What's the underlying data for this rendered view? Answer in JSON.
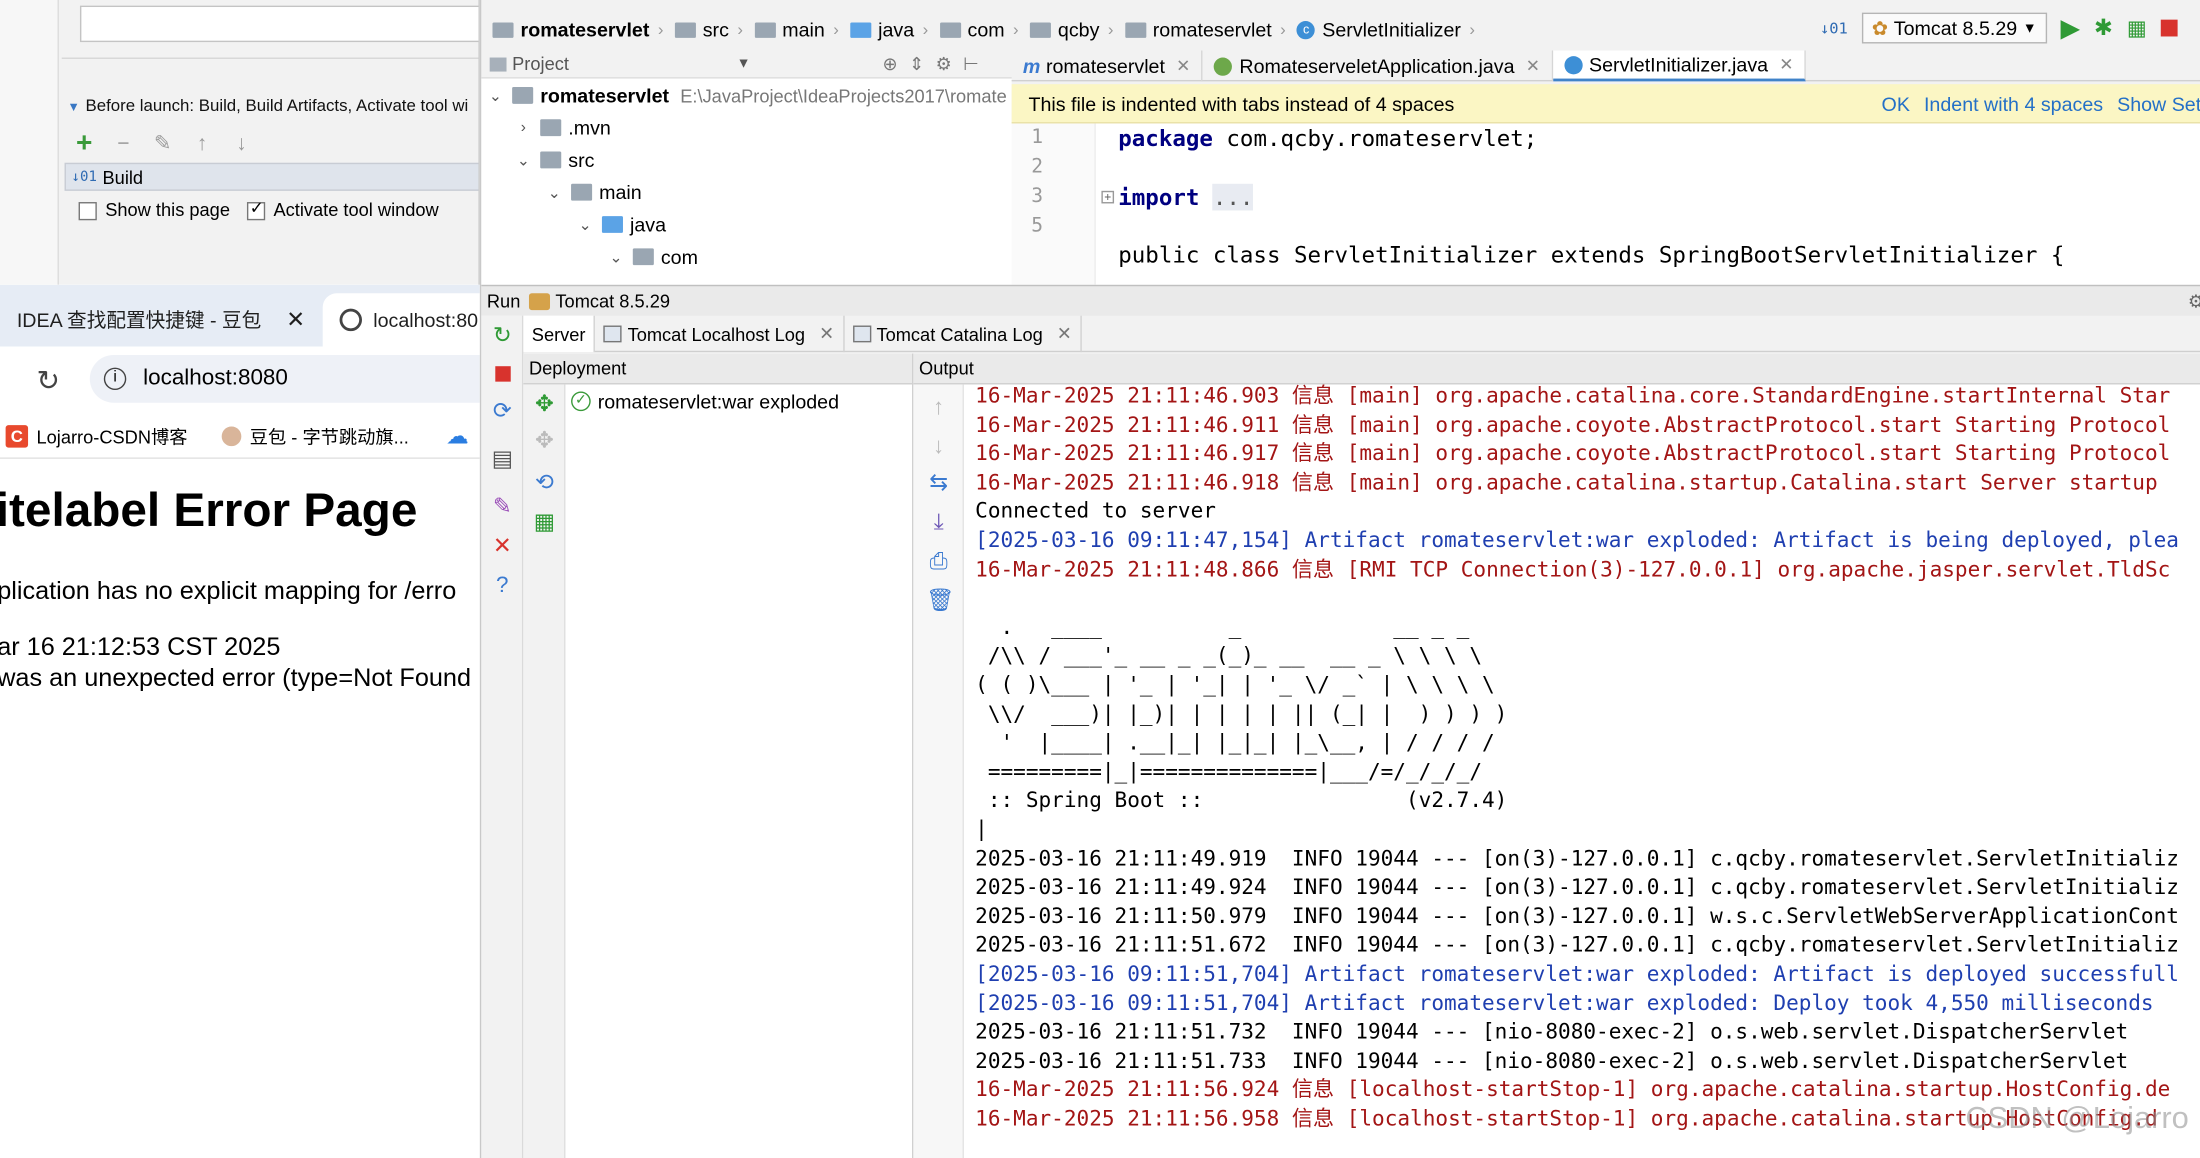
{
  "run_config": {
    "before_launch": "Before launch: Build, Build Artifacts, Activate tool wi",
    "build_item": "Build",
    "show_this_page": "Show this page",
    "activate_tool_window": "Activate tool window"
  },
  "browser": {
    "tabs": [
      {
        "label": "IDEA 查找配置快捷键 - 豆包"
      },
      {
        "label": "localhost:80"
      }
    ],
    "address": "localhost:8080",
    "bookmarks": [
      {
        "label": "Lojarro-CSDN博客"
      },
      {
        "label": "豆包 - 字节跳动旗..."
      }
    ],
    "error_page": {
      "title": "itelabel Error Page",
      "message": "plication has no explicit mapping for /erro",
      "date": "ar 16 21:12:53 CST 2025",
      "detail": "was an unexpected error (type=Not Found"
    }
  },
  "ide": {
    "breadcrumbs": [
      "romateservlet",
      "src",
      "main",
      "java",
      "com",
      "qcby",
      "romateservlet",
      "ServletInitializer"
    ],
    "run_config_name": "Tomcat 8.5.29",
    "project_panel": {
      "title": "Project",
      "tree": [
        {
          "label": "romateservlet",
          "path": "E:\\JavaProject\\IdeaProjects2017\\romate"
        },
        {
          "label": ".mvn"
        },
        {
          "label": "src"
        },
        {
          "label": "main"
        },
        {
          "label": "java"
        },
        {
          "label": "com"
        }
      ]
    },
    "editor_tabs": [
      {
        "label": "romateservlet"
      },
      {
        "label": "RomateserveletApplication.java"
      },
      {
        "label": "ServletInitializer.java"
      }
    ],
    "banner": {
      "message": "This file is indented with tabs instead of 4 spaces",
      "ok": "OK",
      "indent": "Indent with 4 spaces",
      "show": "Show Setti"
    },
    "code": {
      "line_numbers": [
        "1",
        "2",
        "3",
        "5"
      ],
      "package_kw": "package",
      "package_name": " com.qcby.romateservlet;",
      "import_kw": "import",
      "import_dots": "...",
      "partial": "public class ServletInitializer extends SpringBootServletInitializer {"
    },
    "run_panel": {
      "title": "Run",
      "config": "Tomcat 8.5.29",
      "tabs": [
        "Server",
        "Tomcat Localhost Log",
        "Tomcat Catalina Log"
      ],
      "deployment_header": "Deployment",
      "output_header": "Output",
      "artifact": "romateservlet:war exploded"
    },
    "console_lines": [
      {
        "text": "16-Mar-2025 21:11:46.903 信息 [main] org.apache.catalina.core.StandardEngine.startInternal Star",
        "color": "red"
      },
      {
        "text": "16-Mar-2025 21:11:46.911 信息 [main] org.apache.coyote.AbstractProtocol.start Starting Protocol",
        "color": "red"
      },
      {
        "text": "16-Mar-2025 21:11:46.917 信息 [main] org.apache.coyote.AbstractProtocol.start Starting Protocol",
        "color": "red"
      },
      {
        "text": "16-Mar-2025 21:11:46.918 信息 [main] org.apache.catalina.startup.Catalina.start Server startup",
        "color": "red"
      },
      {
        "text": "Connected to server",
        "color": "black"
      },
      {
        "text": "[2025-03-16 09:11:47,154] Artifact romateservlet:war exploded: Artifact is being deployed, plea",
        "color": "blue"
      },
      {
        "text": "16-Mar-2025 21:11:48.866 信息 [RMI TCP Connection(3)-127.0.0.1] org.apache.jasper.servlet.TldSc",
        "color": "red"
      },
      {
        "text": "",
        "color": "black"
      },
      {
        "text": "  .   ____          _            __ _ _",
        "color": "black"
      },
      {
        "text": " /\\\\ / ___'_ __ _ _(_)_ __  __ _ \\ \\ \\ \\",
        "color": "black"
      },
      {
        "text": "( ( )\\___ | '_ | '_| | '_ \\/ _` | \\ \\ \\ \\",
        "color": "black"
      },
      {
        "text": " \\\\/  ___)| |_)| | | | | || (_| |  ) ) ) )",
        "color": "black"
      },
      {
        "text": "  '  |____| .__|_| |_|_| |_\\__, | / / / /",
        "color": "black"
      },
      {
        "text": " =========|_|==============|___/=/_/_/_/",
        "color": "black"
      },
      {
        "text": " :: Spring Boot ::                (v2.7.4)",
        "color": "black"
      },
      {
        "text": "|",
        "color": "black"
      },
      {
        "text": "2025-03-16 21:11:49.919  INFO 19044 --- [on(3)-127.0.0.1] c.qcby.romateservlet.ServletInitializ",
        "color": "black"
      },
      {
        "text": "2025-03-16 21:11:49.924  INFO 19044 --- [on(3)-127.0.0.1] c.qcby.romateservlet.ServletInitializ",
        "color": "black"
      },
      {
        "text": "2025-03-16 21:11:50.979  INFO 19044 --- [on(3)-127.0.0.1] w.s.c.ServletWebServerApplicationCont",
        "color": "black"
      },
      {
        "text": "2025-03-16 21:11:51.672  INFO 19044 --- [on(3)-127.0.0.1] c.qcby.romateservlet.ServletInitializ",
        "color": "black"
      },
      {
        "text": "[2025-03-16 09:11:51,704] Artifact romateservlet:war exploded: Artifact is deployed successfull",
        "color": "blue"
      },
      {
        "text": "[2025-03-16 09:11:51,704] Artifact romateservlet:war exploded: Deploy took 4,550 milliseconds",
        "color": "blue"
      },
      {
        "text": "2025-03-16 21:11:51.732  INFO 19044 --- [nio-8080-exec-2] o.s.web.servlet.DispatcherServlet",
        "color": "black"
      },
      {
        "text": "2025-03-16 21:11:51.733  INFO 19044 --- [nio-8080-exec-2] o.s.web.servlet.DispatcherServlet",
        "color": "black"
      },
      {
        "text": "16-Mar-2025 21:11:56.924 信息 [localhost-startStop-1] org.apache.catalina.startup.HostConfig.de",
        "color": "red"
      },
      {
        "text": "16-Mar-2025 21:11:56.958 信息 [localhost-startStop-1] org.apache.catalina.startup.HostConfig.d",
        "color": "red"
      }
    ],
    "watermark": "CSDN @Lojarro"
  }
}
